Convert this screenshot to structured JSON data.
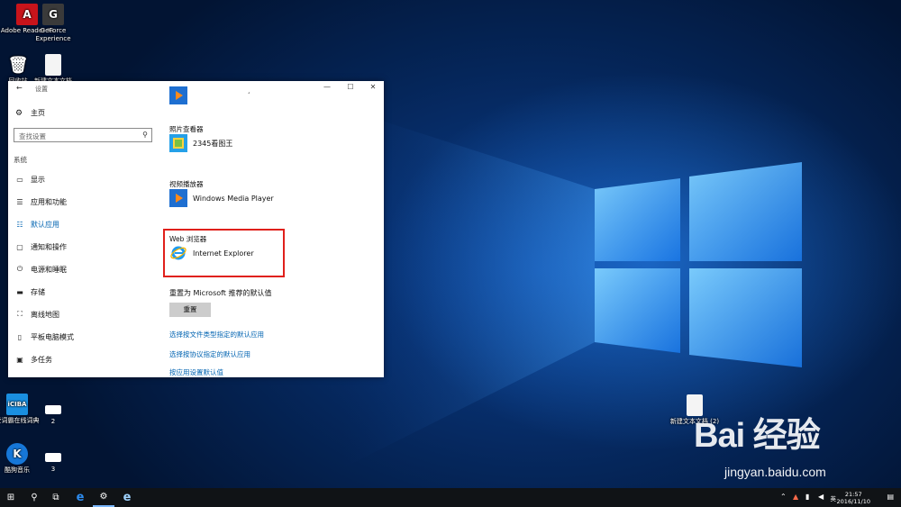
{
  "desktop": {
    "icons": [
      {
        "label": "Adobe Reader XI",
        "icon": "adobe-reader-icon",
        "color": "#c8141b",
        "glyph": "A"
      },
      {
        "label": "GeForce Experience",
        "icon": "geforce-icon",
        "color": "#3a3a3a",
        "glyph": "G"
      },
      {
        "label": "回收站",
        "icon": "recycle-bin-icon"
      },
      {
        "label": "新建文本文档",
        "icon": "text-document-icon"
      },
      {
        "label": "爱词霸在线词典",
        "icon": "iciba-icon",
        "color": "#1a8fe0",
        "glyph": "iCIBA"
      },
      {
        "label": "酷狗音乐",
        "icon": "kugou-icon",
        "color": "#1677d8",
        "glyph": "K"
      },
      {
        "label": "新建文本文档 (2)",
        "icon": "text-document-icon"
      }
    ],
    "small_icons": [
      {
        "label": "2"
      },
      {
        "label": "3"
      }
    ],
    "watermark": {
      "logo": "Bai 经验",
      "url": "jingyan.baidu.com"
    }
  },
  "settings": {
    "title": "设置",
    "back": "←",
    "controls": {
      "minimize": "—",
      "maximize": "☐",
      "close": "✕"
    },
    "home_label": "主页",
    "search_placeholder": "查找设置",
    "section_label": "系统",
    "nav": [
      {
        "label": "显示",
        "icon": "monitor-icon",
        "glyph": "▭"
      },
      {
        "label": "应用和功能",
        "icon": "apps-list-icon",
        "glyph": "☰"
      },
      {
        "label": "默认应用",
        "icon": "default-apps-icon",
        "glyph": "☷",
        "active": true
      },
      {
        "label": "通知和操作",
        "icon": "notification-icon",
        "glyph": "▢"
      },
      {
        "label": "电源和睡眠",
        "icon": "power-icon",
        "glyph": "⏻"
      },
      {
        "label": "存储",
        "icon": "storage-icon",
        "glyph": "▬"
      },
      {
        "label": "离线地图",
        "icon": "map-icon",
        "glyph": "⛶"
      },
      {
        "label": "平板电脑模式",
        "icon": "tablet-icon",
        "glyph": "▯"
      },
      {
        "label": "多任务",
        "icon": "multitask-icon",
        "glyph": "▣"
      }
    ],
    "content": {
      "top_partial": "ˊ",
      "photo_viewer_label": "照片查看器",
      "photo_viewer_app": "2345看图王",
      "video_player_label": "视频播放器",
      "video_player_app": "Windows Media Player",
      "browser_label": "Web 浏览器",
      "browser_app": "Internet Explorer",
      "reset_label": "重置为 Microsoft 推荐的默认值",
      "reset_button": "重置",
      "links": [
        "选择按文件类型指定的默认应用",
        "选择按协议指定的默认应用",
        "按应用设置默认值"
      ]
    },
    "highlight_color": "#e0201b",
    "accent_color": "#0063b1"
  },
  "taskbar": {
    "start": "⊞",
    "search": "⚲",
    "task_view": "⧉",
    "edge": "e",
    "settings": "⚙",
    "ie": "e",
    "lang": "英",
    "time": "21:57",
    "date": "2016/11/10",
    "notif": "▤"
  }
}
